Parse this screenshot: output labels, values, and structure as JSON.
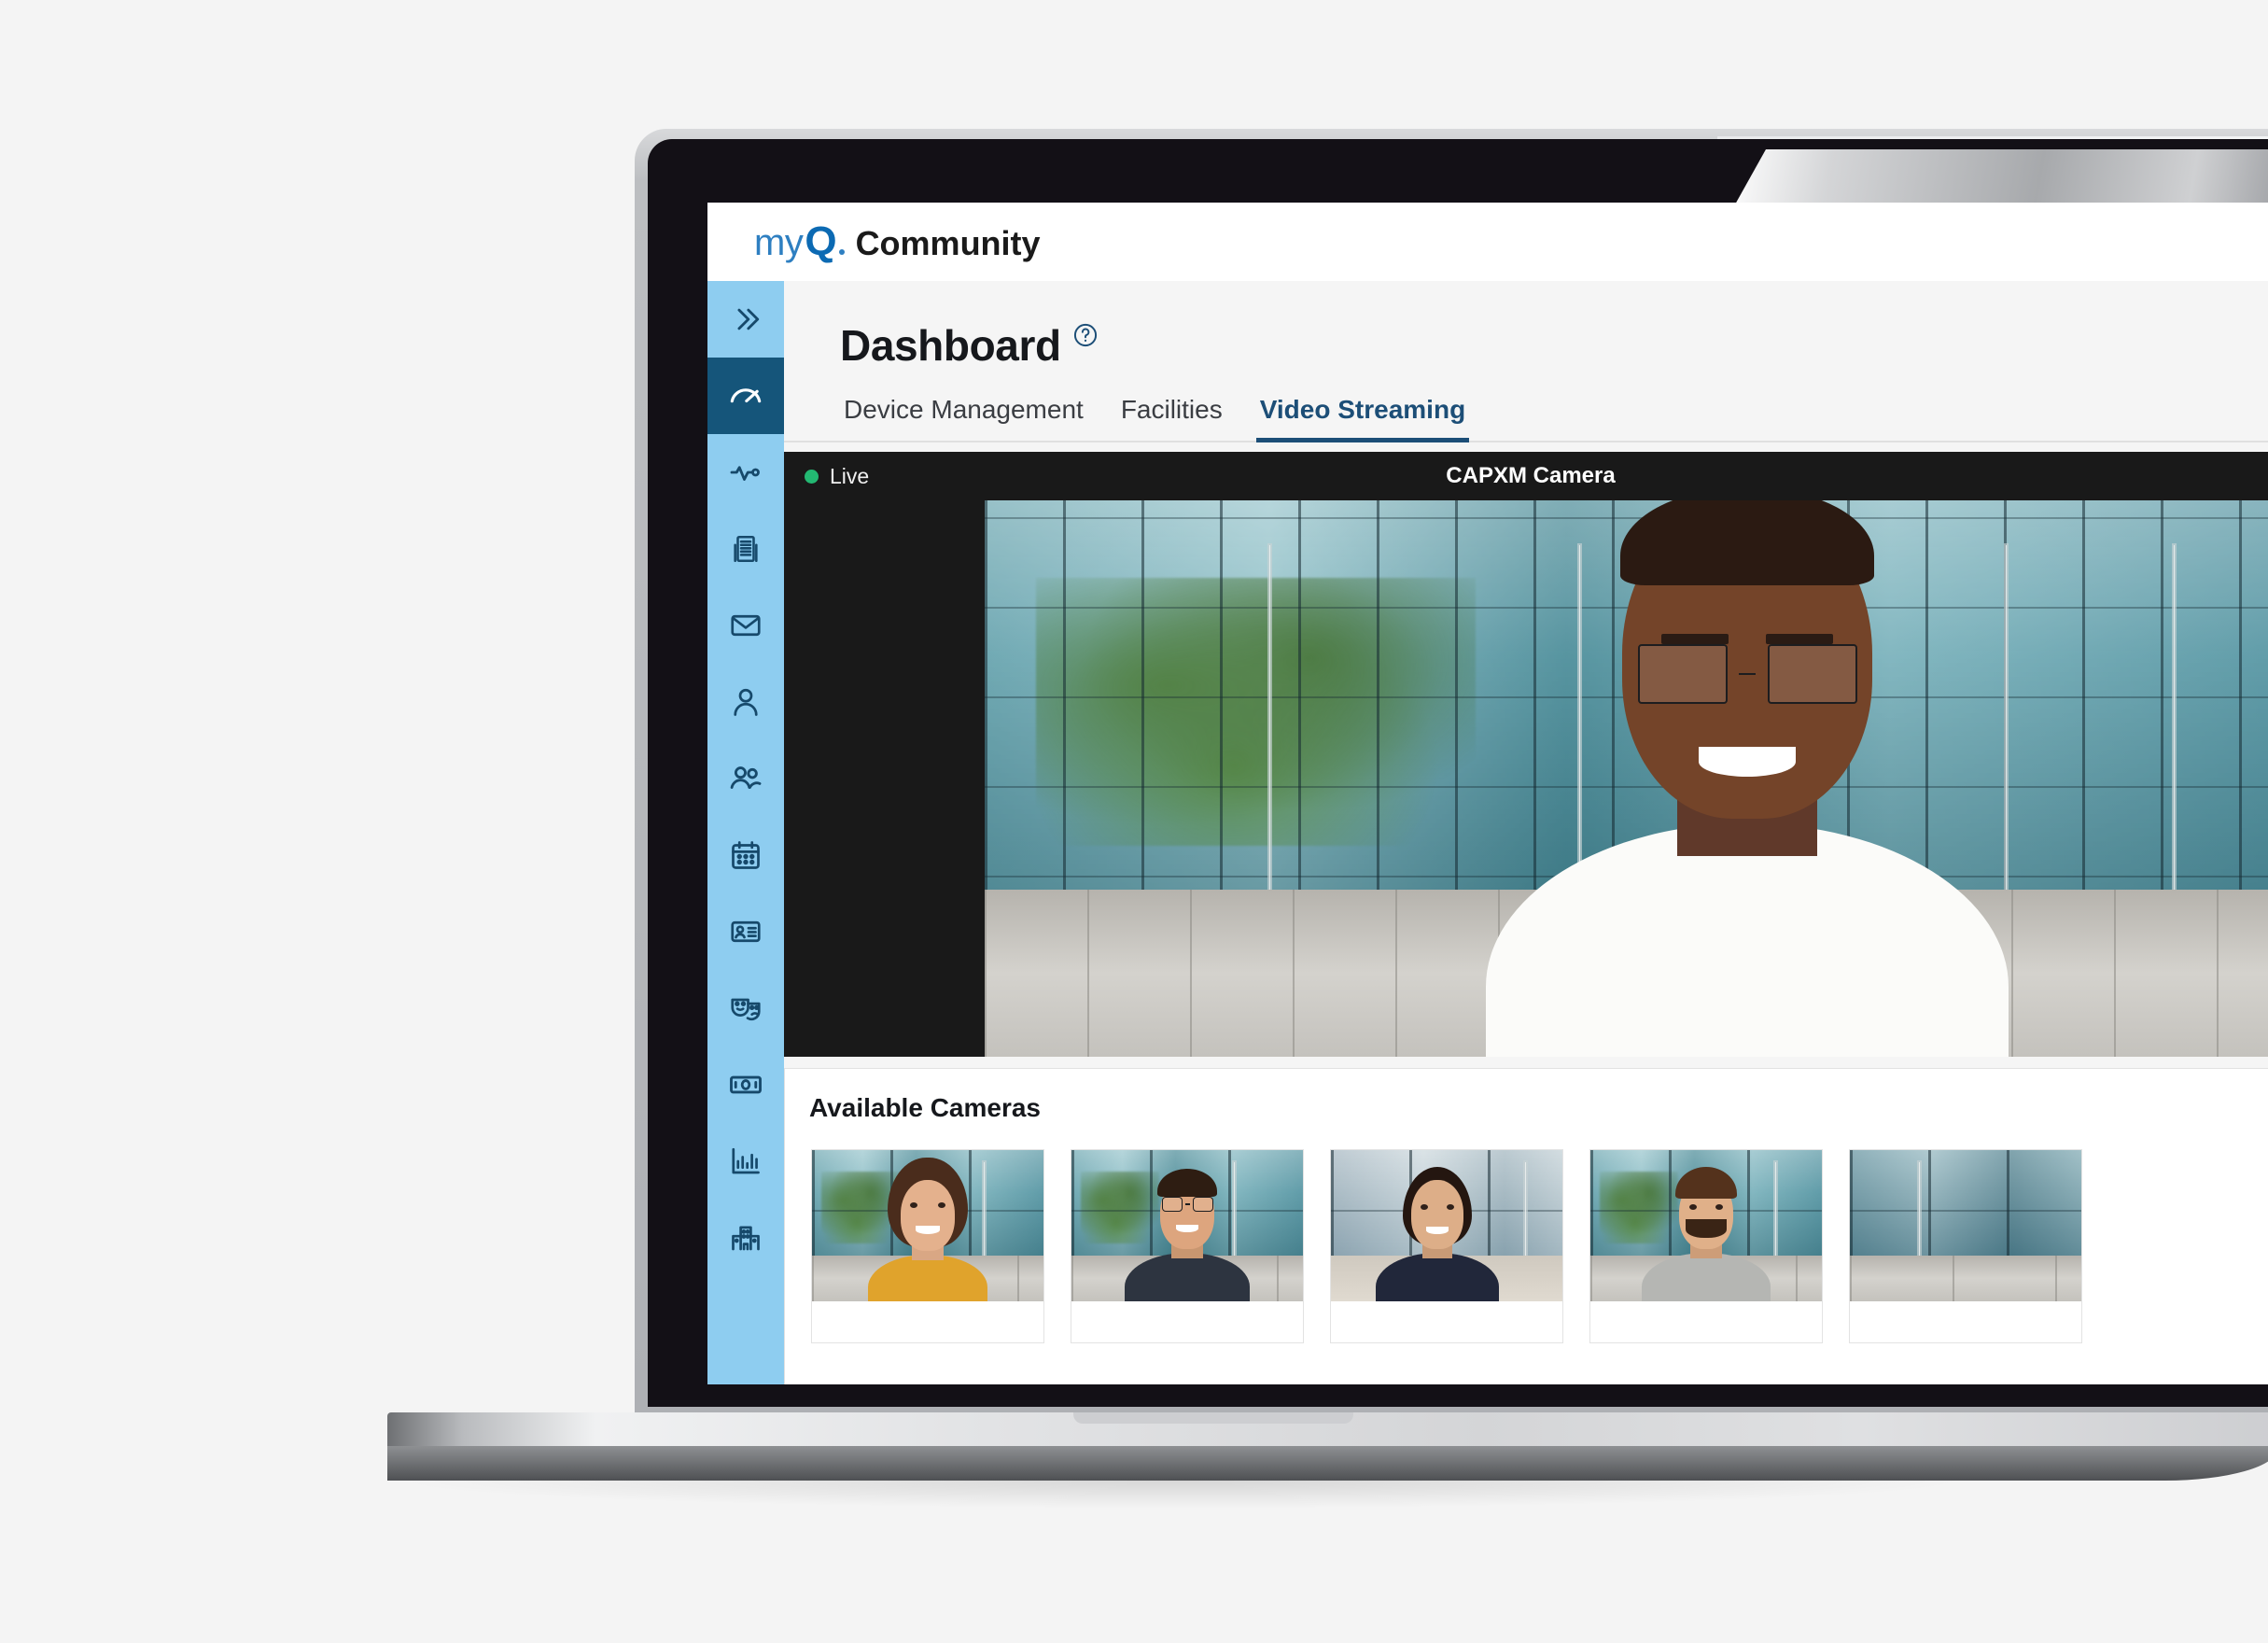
{
  "app": {
    "brand": {
      "my": "my",
      "q": "Q",
      "suffix": "Community"
    }
  },
  "sidebar": {
    "items": [
      {
        "name": "expand-sidebar",
        "icon": "chevrons-right-icon",
        "active": false
      },
      {
        "name": "dashboard",
        "icon": "gauge-icon",
        "active": true
      },
      {
        "name": "activity",
        "icon": "pulse-icon",
        "active": false
      },
      {
        "name": "documents",
        "icon": "building-document-icon",
        "active": false
      },
      {
        "name": "messages",
        "icon": "envelope-icon",
        "active": false
      },
      {
        "name": "residents",
        "icon": "user-icon",
        "active": false
      },
      {
        "name": "groups",
        "icon": "users-icon",
        "active": false
      },
      {
        "name": "calendar",
        "icon": "calendar-icon",
        "active": false
      },
      {
        "name": "credentials",
        "icon": "id-card-icon",
        "active": false
      },
      {
        "name": "amenities",
        "icon": "theater-masks-icon",
        "active": false
      },
      {
        "name": "payments",
        "icon": "banknote-icon",
        "active": false
      },
      {
        "name": "reports",
        "icon": "bar-chart-icon",
        "active": false
      },
      {
        "name": "properties",
        "icon": "buildings-icon",
        "active": false
      }
    ]
  },
  "page": {
    "title": "Dashboard",
    "help_icon": "question-circle-icon"
  },
  "tabs": [
    {
      "label": "Device Management",
      "active": false
    },
    {
      "label": "Facilities",
      "active": false
    },
    {
      "label": "Video Streaming",
      "active": true
    }
  ],
  "player": {
    "status_label": "Live",
    "status_color": "#23b872",
    "camera_name": "CAPXM Camera",
    "background_color": "#191919"
  },
  "cameras": {
    "title": "Available Cameras",
    "thumbnails": [
      {
        "subject": "woman-yellow-sweater"
      },
      {
        "subject": "man-glasses-dark-shirt"
      },
      {
        "subject": "woman-polka-dot-blouse"
      },
      {
        "subject": "man-beard-grey-shirt"
      },
      {
        "subject": "partial-camera-view"
      }
    ]
  },
  "colors": {
    "sidebar_bg": "#8ecdf0",
    "sidebar_active_bg": "#15557a",
    "accent_navy": "#1c4e77",
    "brand_blue": "#0c6ab3",
    "page_bg": "#f5f5f5"
  }
}
